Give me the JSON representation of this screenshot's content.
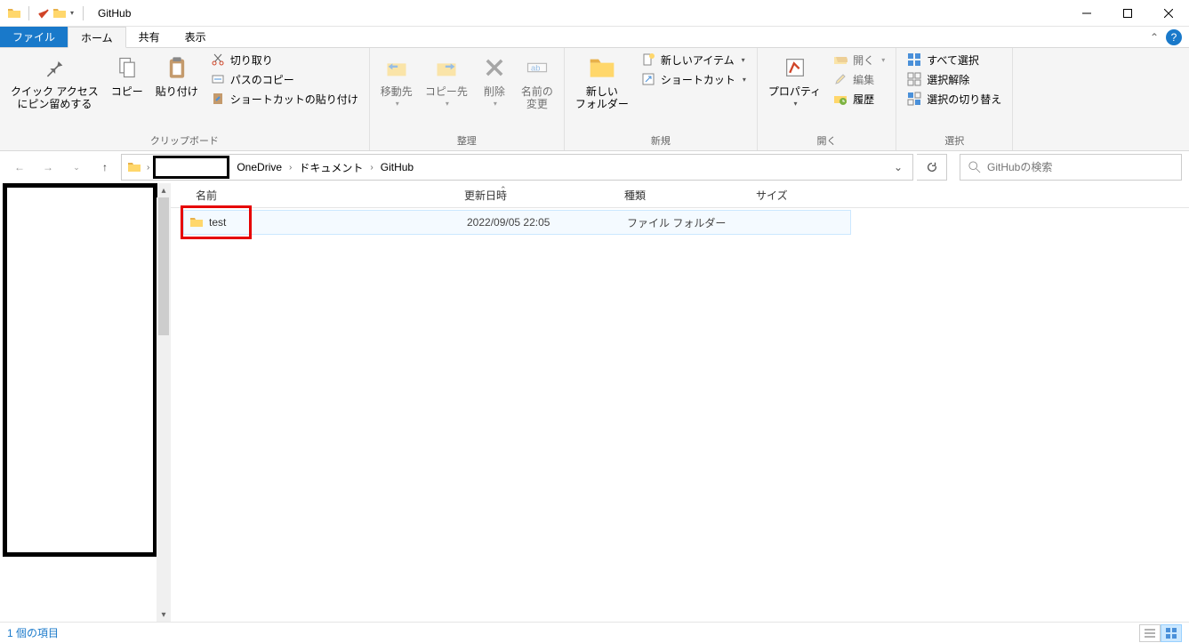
{
  "window": {
    "title": "GitHub"
  },
  "tabs": {
    "file": "ファイル",
    "home": "ホーム",
    "share": "共有",
    "view": "表示"
  },
  "ribbon": {
    "clipboard": {
      "label": "クリップボード",
      "pin": "クイック アクセス\nにピン留めする",
      "copy": "コピー",
      "paste": "貼り付け",
      "cut": "切り取り",
      "copy_path": "パスのコピー",
      "paste_shortcut": "ショートカットの貼り付け"
    },
    "organize": {
      "label": "整理",
      "move_to": "移動先",
      "copy_to": "コピー先",
      "delete": "削除",
      "rename": "名前の\n変更"
    },
    "new": {
      "label": "新規",
      "new_folder": "新しい\nフォルダー",
      "new_item": "新しいアイテム",
      "shortcut": "ショートカット"
    },
    "open": {
      "label": "開く",
      "properties": "プロパティ",
      "open": "開く",
      "edit": "編集",
      "history": "履歴"
    },
    "select": {
      "label": "選択",
      "select_all": "すべて選択",
      "select_none": "選択解除",
      "invert": "選択の切り替え"
    }
  },
  "breadcrumb": {
    "seg1": "OneDrive",
    "seg2": "ドキュメント",
    "seg3": "GitHub"
  },
  "search": {
    "placeholder": "GitHubの検索"
  },
  "columns": {
    "name": "名前",
    "date": "更新日時",
    "type": "種類",
    "size": "サイズ"
  },
  "rows": [
    {
      "name": "test",
      "date": "2022/09/05 22:05",
      "type": "ファイル フォルダー",
      "size": ""
    }
  ],
  "status": {
    "count": "1 個の項目"
  }
}
